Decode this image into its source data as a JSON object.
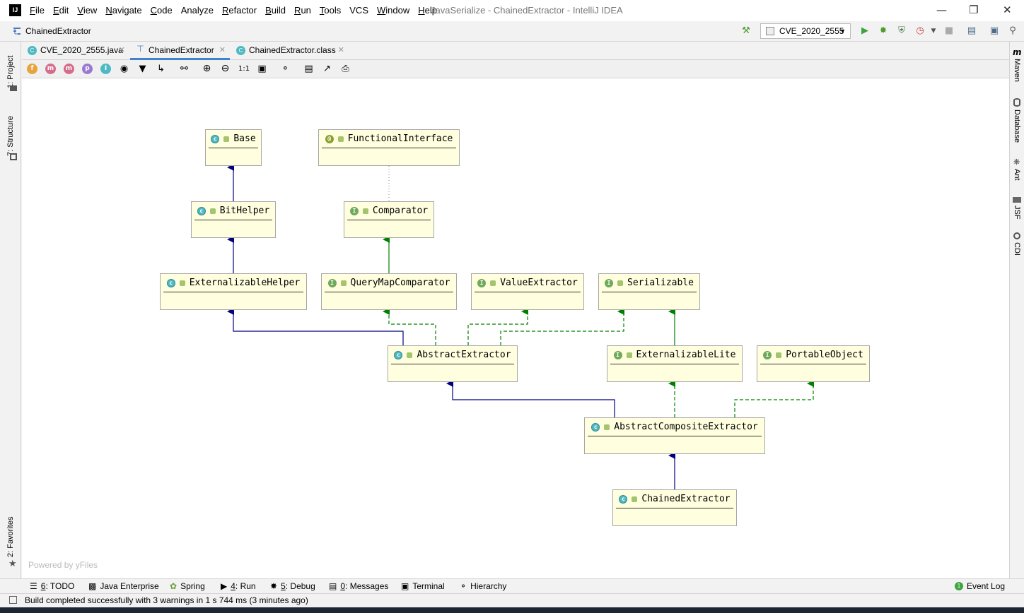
{
  "window": {
    "title": "JavaSerialize - ChainedExtractor - IntelliJ IDEA",
    "logo_text": "IJ"
  },
  "menu": [
    {
      "mn": "F",
      "rest": "ile"
    },
    {
      "mn": "E",
      "rest": "dit"
    },
    {
      "mn": "V",
      "rest": "iew"
    },
    {
      "mn": "N",
      "rest": "avigate"
    },
    {
      "mn": "C",
      "rest": "ode"
    },
    {
      "mn": "",
      "rest": "Analyze"
    },
    {
      "mn": "R",
      "rest": "efactor"
    },
    {
      "mn": "B",
      "rest": "uild"
    },
    {
      "mn": "R",
      "rest": "un"
    },
    {
      "mn": "T",
      "rest": "ools"
    },
    {
      "mn": "",
      "rest": "VCS"
    },
    {
      "mn": "W",
      "rest": "indow"
    },
    {
      "mn": "H",
      "rest": "elp"
    }
  ],
  "navbar": {
    "breadcrumb": "ChainedExtractor",
    "run_config": "CVE_2020_2555"
  },
  "tabs": [
    {
      "label": "CVE_2020_2555.java",
      "active": false
    },
    {
      "label": "ChainedExtractor",
      "active": true
    },
    {
      "label": "ChainedExtractor.class",
      "active": false
    }
  ],
  "diagram_toolbar": {
    "filters": [
      "f",
      "m",
      "m",
      "p",
      "I"
    ],
    "zoom_actual": "1:1"
  },
  "left_tools": {
    "project": "1: Project",
    "structure": "7: Structure",
    "favorites": "2: Favorites"
  },
  "right_tools": [
    "Maven",
    "Database",
    "Ant",
    "JSF",
    "CDI"
  ],
  "nodes": [
    {
      "name": "Base",
      "kind": "c"
    },
    {
      "name": "FunctionalInterface",
      "kind": "@"
    },
    {
      "name": "BitHelper",
      "kind": "c"
    },
    {
      "name": "Comparator",
      "kind": "I"
    },
    {
      "name": "ExternalizableHelper",
      "kind": "c"
    },
    {
      "name": "QueryMapComparator",
      "kind": "I"
    },
    {
      "name": "ValueExtractor",
      "kind": "I"
    },
    {
      "name": "Serializable",
      "kind": "I"
    },
    {
      "name": "AbstractExtractor",
      "kind": "c"
    },
    {
      "name": "ExternalizableLite",
      "kind": "I"
    },
    {
      "name": "PortableObject",
      "kind": "I"
    },
    {
      "name": "AbstractCompositeExtractor",
      "kind": "c"
    },
    {
      "name": "ChainedExtractor",
      "kind": "c"
    }
  ],
  "powered_by": "Powered by yFiles",
  "bottom_tools": [
    {
      "num": "6",
      "label": ": TODO"
    },
    {
      "num": "",
      "label": "Java Enterprise"
    },
    {
      "num": "",
      "label": "Spring"
    },
    {
      "num": "4",
      "label": ": Run"
    },
    {
      "num": "5",
      "label": ": Debug"
    },
    {
      "num": "0",
      "label": ": Messages"
    },
    {
      "num": "",
      "label": "Terminal"
    },
    {
      "num": "",
      "label": "Hierarchy"
    }
  ],
  "event_log": {
    "count": "1",
    "label": "Event Log"
  },
  "status": "Build completed successfully with 3 warnings in 1 s 744 ms (3 minutes ago)",
  "colors": {
    "node_fill": "#ffffdf",
    "extends_edge": "#000080",
    "implements_edge": "#008000",
    "tab_accent": "#4083c9"
  }
}
